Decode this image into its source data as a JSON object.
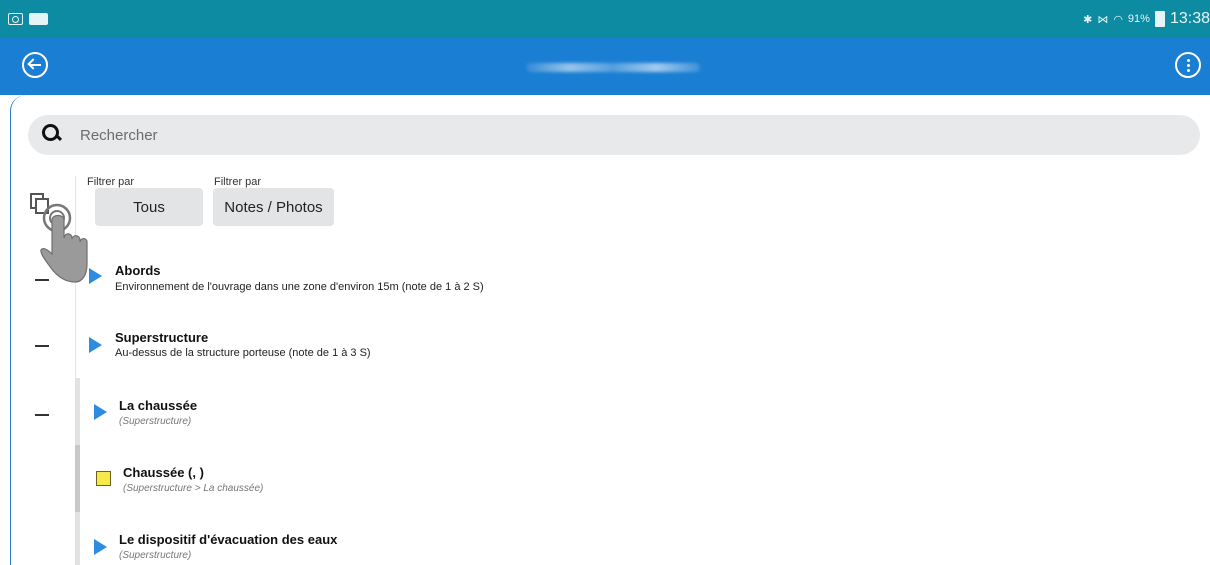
{
  "status_bar": {
    "left_icons": [
      "p-notification-icon",
      "gallery-notification-icon"
    ],
    "battery_percent": "91%",
    "time": "13:38",
    "icons": [
      "bluetooth-icon",
      "mute-icon",
      "wifi-icon",
      "battery-icon"
    ],
    "background": "#0d8ba3"
  },
  "app_bar": {
    "background": "#1a7ed3",
    "back_icon": "back-arrow-icon",
    "menu_icon": "more-vertical-icon"
  },
  "search": {
    "placeholder": "Rechercher",
    "icon": "search-icon"
  },
  "filters": [
    {
      "label": "Filtrer par",
      "value": "Tous"
    },
    {
      "label": "Filtrer par",
      "value": "Notes / Photos"
    }
  ],
  "items": [
    {
      "title": "Abords",
      "subtitle": "Environnement de l'ouvrage dans une zone d'environ 15m (note de 1 à 2 S)"
    },
    {
      "title": "Superstructure",
      "subtitle": "Au-dessus de la structure porteuse (note de 1 à 3 S)"
    },
    {
      "title": "La chaussée",
      "subtitle": "(Superstructure)"
    },
    {
      "title": "Chaussée (, )",
      "subtitle": "(Superstructure > La chaussée)"
    },
    {
      "title": "Le dispositif d'évacuation des eaux",
      "subtitle": "(Superstructure)"
    }
  ],
  "colors": {
    "accent_arrow": "#2c8ce0",
    "note_yellow": "#f8e94b"
  }
}
